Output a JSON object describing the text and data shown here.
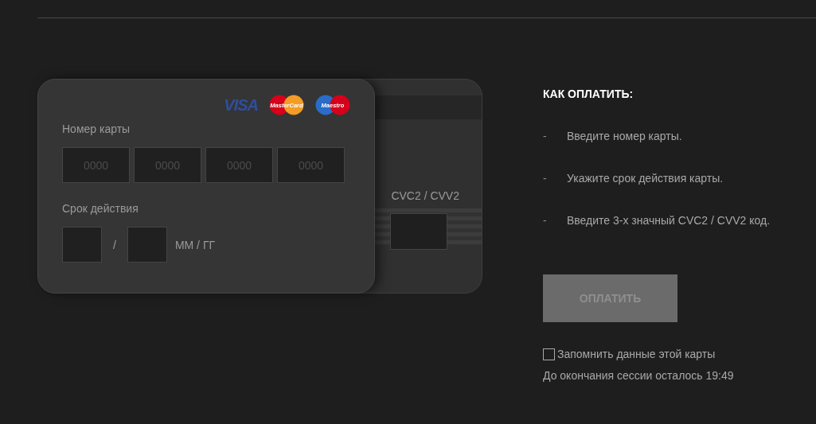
{
  "card_front": {
    "brands": [
      {
        "kind": "visa",
        "label": "VISA"
      },
      {
        "kind": "mastercard",
        "label": "MasterCard"
      },
      {
        "kind": "maestro",
        "label": "Maestro"
      }
    ],
    "number_label": "Номер карты",
    "number_fields": [
      {
        "placeholder": "0000"
      },
      {
        "placeholder": "0000"
      },
      {
        "placeholder": "0000"
      },
      {
        "placeholder": "0000"
      }
    ],
    "expiry_label": "Срок действия",
    "expiry_separator": "/",
    "expiry_hint": "ММ / ГГ"
  },
  "card_back": {
    "cvc_label": "CVC2 / CVV2"
  },
  "instructions": {
    "title": "КАК ОПЛАТИТЬ:",
    "steps": [
      {
        "bullet": "-",
        "text": "Введите номер карты."
      },
      {
        "bullet": "-",
        "text": "Укажите срок действия карты."
      },
      {
        "bullet": "-",
        "text": "Введите 3-х значный CVC2 / CVV2 код."
      }
    ]
  },
  "pay_button": {
    "label": "ОПЛАТИТЬ",
    "disabled": true
  },
  "remember": {
    "label": "Запомнить данные этой карты",
    "checked": false
  },
  "session": "До окончания сессии осталось 19:49"
}
